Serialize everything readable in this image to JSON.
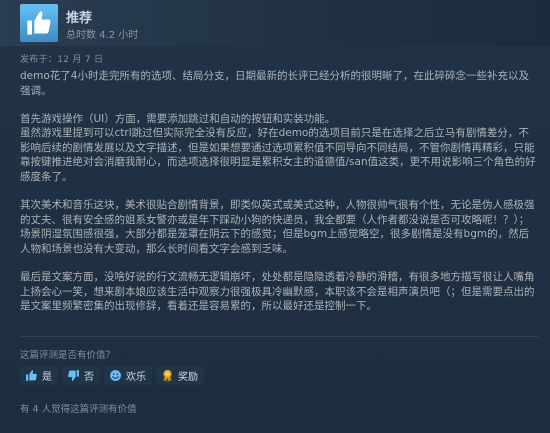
{
  "review": {
    "verdict": "推荐",
    "hours": "总时数 4.2 小时",
    "posted": "发布于：12 月 7 日",
    "paragraphs": [
      "demo花了4小时走完所有的选项、结局分支，日期最新的长评已经分析的很明晰了，在此碎碎念一些补充以及强调。",
      "首先游戏操作（UI）方面，需要添加跳过和自动的按钮和实装功能。\n虽然游戏里提到可以ctrl跳过但实际完全没有反应，好在demo的选项目前只是在选择之后立马有剧情差分，不影响后续的剧情发展以及文字描述，但是如果想要通过选项累积值不同导向不同结局，不管你剧情再精彩，只能靠按键推进绝对会消磨我耐心，而选项选择很明显是累积女主的道德值/san值这类，更不用说影响三个角色的好感度条了。",
      "其次美术和音乐这块，美术很贴合剧情背景，即类似英式或美式这种，人物很帅气很有个性，无论是伪人感极强的丈夫、很有安全感的姐系女警亦或是年下踩动小狗的快递员，我全都要（人作者都没说是否可攻略呢！？）；场景阴湿氛围感很强，大部分都是笼罩在阴云下的感觉；但是bgm上感觉略空，很多剧情是没有bgm的，然后人物和场景也没有大变动，那么长时间看文字会感到乏味。",
      "最后是文案方面，没啥好说的行文流畅无逻辑崩坏，处处都是隐隐透着冷静的滑稽，有很多地方描写很让人嘴角上扬会心一笑，想来剧本娘应该生活中观察力很强极具冷幽默感，本职该不会是相声演员吧（；但是需要点出的是文案里频繁密集的出现修辞，看着还是容易累的，所以最好还是控制一下。"
    ]
  },
  "helpful": {
    "question": "这篇评测是否有价值？",
    "buttons": {
      "yes": "是",
      "no": "否",
      "funny": "欢乐",
      "award": "奖励"
    },
    "count_text": "有 4 人觉得这篇评测有价值"
  },
  "icons": {
    "verdict": "thumbs-up-icon",
    "yes": "thumbs-up-icon",
    "no": "thumbs-down-icon",
    "funny": "smiley-icon",
    "award": "award-icon"
  },
  "colors": {
    "accent": "#67c1f5",
    "background": "#1b2838",
    "award": "#e4a530"
  }
}
